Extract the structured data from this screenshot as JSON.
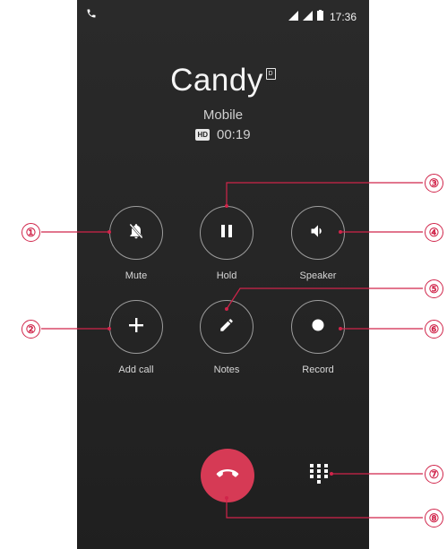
{
  "status_bar": {
    "time": "17:36"
  },
  "caller": {
    "name": "Candy",
    "sim_badge": "D",
    "type": "Mobile"
  },
  "call": {
    "hd_badge": "HD",
    "duration": "00:19"
  },
  "controls": {
    "mute_label": "Mute",
    "hold_label": "Hold",
    "speaker_label": "Speaker",
    "add_call_label": "Add call",
    "notes_label": "Notes",
    "record_label": "Record"
  },
  "callouts": [
    "①",
    "②",
    "③",
    "④",
    "⑤",
    "⑥",
    "⑦",
    "⑧"
  ],
  "colors": {
    "accent": "#d0244a",
    "end_call": "#d63a55",
    "background": "#262626"
  },
  "icons": {
    "mute": "bell-off-icon",
    "hold": "pause-icon",
    "speaker": "speaker-icon",
    "add_call": "plus-icon",
    "notes": "pencil-icon",
    "record": "record-icon",
    "end_call": "phone-hangup-icon",
    "dialpad": "dialpad-icon"
  }
}
